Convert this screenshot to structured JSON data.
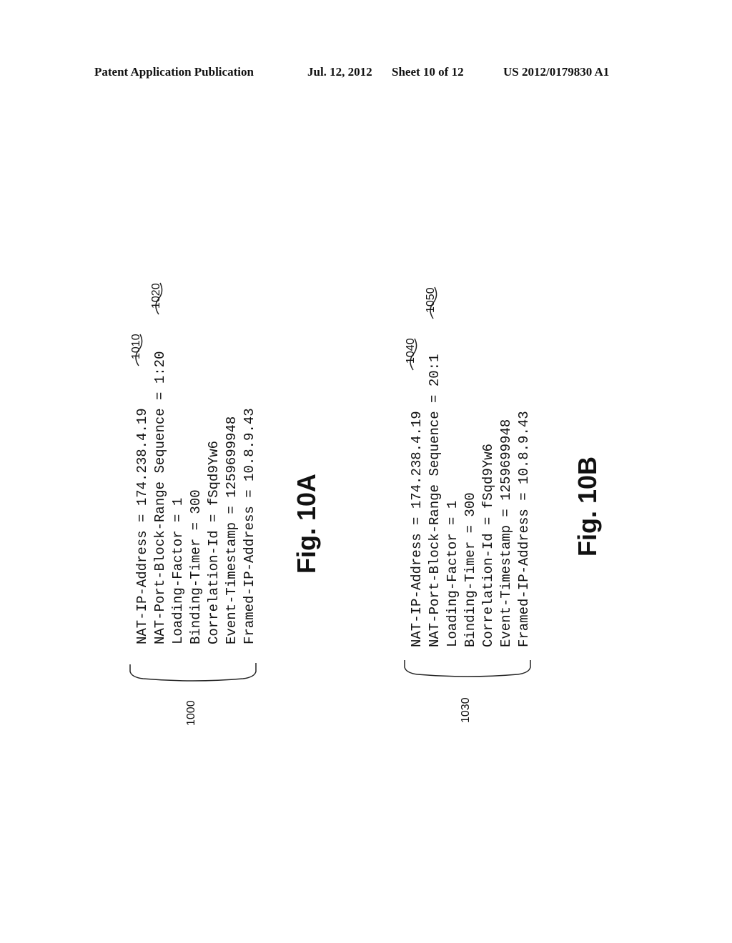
{
  "header": {
    "publication": "Patent Application Publication",
    "date": "Jul. 12, 2012",
    "sheet": "Sheet 10 of 12",
    "number": "US 2012/0179830 A1"
  },
  "figures": [
    {
      "ref": "1000",
      "caption": "Fig. 10A",
      "lines": [
        "NAT-IP-Address = 174.238.4.19",
        "NAT-Port-Block-Range Sequence = 1:20",
        "Loading-Factor = 1",
        "Binding-Timer = 300",
        "Correlation-Id = fSqd9Yw6",
        "Event-Timestamp = 1259699948",
        "Framed-IP-Address = 10.8.9.43"
      ],
      "callouts": [
        "1010",
        "1020"
      ]
    },
    {
      "ref": "1030",
      "caption": "Fig. 10B",
      "lines": [
        "NAT-IP-Address = 174.238.4.19",
        "NAT-Port-Block-Range Sequence = 20:1",
        "Loading-Factor = 1",
        "Binding-Timer = 300",
        "Correlation-Id = fSqd9Yw6",
        "Event-Timestamp = 1259699948",
        "Framed-IP-Address = 10.8.9.43"
      ],
      "callouts": [
        "1040",
        "1050"
      ]
    }
  ]
}
